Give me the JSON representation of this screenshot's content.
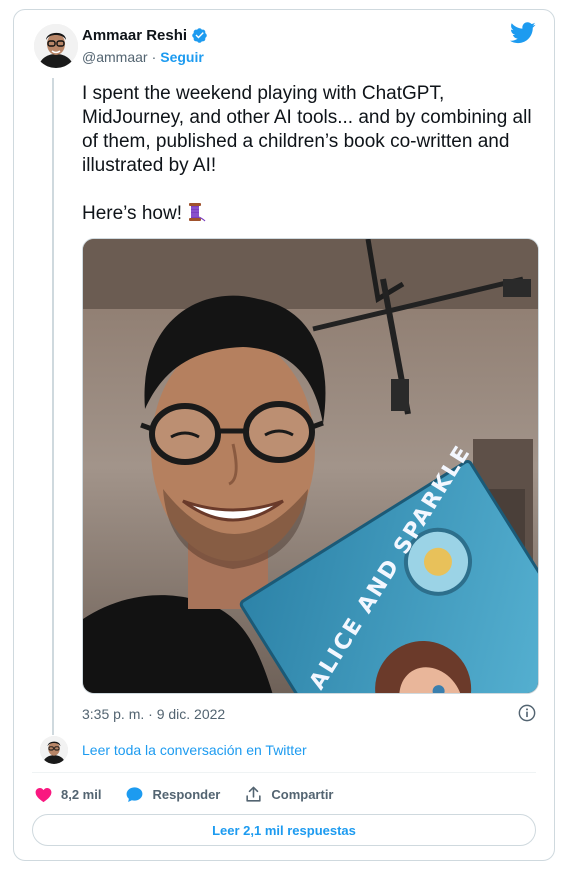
{
  "author": {
    "display_name": "Ammaar Reshi",
    "handle": "@ammaar",
    "separator": "·",
    "follow_label": "Seguir"
  },
  "tweet": {
    "text": "I spent the weekend playing with ChatGPT, MidJourney, and other AI tools... and by combining all of them, published a children’s book co-written and illustrated by AI!\n\nHere’s how!",
    "emoji": "spool-of-thread-icon",
    "timestamp": "3:35 p. m. · 9 dic. 2022"
  },
  "photo": {
    "book_title": "ALICE AND SPARKLE"
  },
  "read_thread_label": "Leer toda la conversación en Twitter",
  "actions": {
    "likes_count": "8,2 mil",
    "reply_label": "Responder",
    "share_label": "Compartir"
  },
  "replies_button_label": "Leer 2,1 mil respuestas",
  "colors": {
    "accent": "#1d9bf0",
    "like": "#f91880",
    "border": "#cfd9de",
    "text": "#0f1419",
    "muted": "#536471"
  }
}
